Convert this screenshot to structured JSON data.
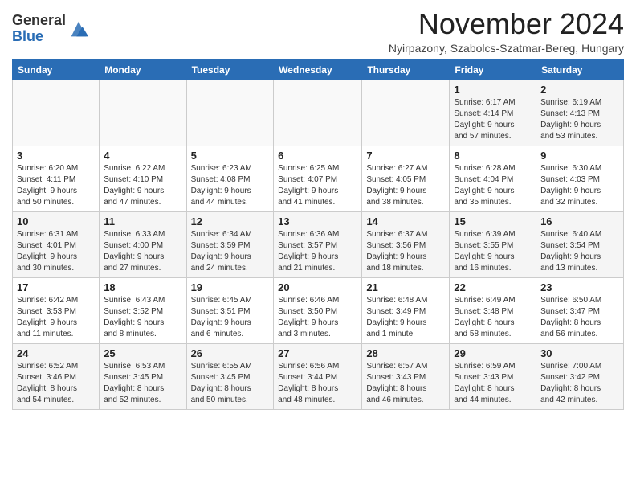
{
  "header": {
    "logo_line1": "General",
    "logo_line2": "Blue",
    "month": "November 2024",
    "location": "Nyirpazony, Szabolcs-Szatmar-Bereg, Hungary"
  },
  "days_of_week": [
    "Sunday",
    "Monday",
    "Tuesday",
    "Wednesday",
    "Thursday",
    "Friday",
    "Saturday"
  ],
  "weeks": [
    [
      {
        "day": "",
        "info": ""
      },
      {
        "day": "",
        "info": ""
      },
      {
        "day": "",
        "info": ""
      },
      {
        "day": "",
        "info": ""
      },
      {
        "day": "",
        "info": ""
      },
      {
        "day": "1",
        "info": "Sunrise: 6:17 AM\nSunset: 4:14 PM\nDaylight: 9 hours\nand 57 minutes."
      },
      {
        "day": "2",
        "info": "Sunrise: 6:19 AM\nSunset: 4:13 PM\nDaylight: 9 hours\nand 53 minutes."
      }
    ],
    [
      {
        "day": "3",
        "info": "Sunrise: 6:20 AM\nSunset: 4:11 PM\nDaylight: 9 hours\nand 50 minutes."
      },
      {
        "day": "4",
        "info": "Sunrise: 6:22 AM\nSunset: 4:10 PM\nDaylight: 9 hours\nand 47 minutes."
      },
      {
        "day": "5",
        "info": "Sunrise: 6:23 AM\nSunset: 4:08 PM\nDaylight: 9 hours\nand 44 minutes."
      },
      {
        "day": "6",
        "info": "Sunrise: 6:25 AM\nSunset: 4:07 PM\nDaylight: 9 hours\nand 41 minutes."
      },
      {
        "day": "7",
        "info": "Sunrise: 6:27 AM\nSunset: 4:05 PM\nDaylight: 9 hours\nand 38 minutes."
      },
      {
        "day": "8",
        "info": "Sunrise: 6:28 AM\nSunset: 4:04 PM\nDaylight: 9 hours\nand 35 minutes."
      },
      {
        "day": "9",
        "info": "Sunrise: 6:30 AM\nSunset: 4:03 PM\nDaylight: 9 hours\nand 32 minutes."
      }
    ],
    [
      {
        "day": "10",
        "info": "Sunrise: 6:31 AM\nSunset: 4:01 PM\nDaylight: 9 hours\nand 30 minutes."
      },
      {
        "day": "11",
        "info": "Sunrise: 6:33 AM\nSunset: 4:00 PM\nDaylight: 9 hours\nand 27 minutes."
      },
      {
        "day": "12",
        "info": "Sunrise: 6:34 AM\nSunset: 3:59 PM\nDaylight: 9 hours\nand 24 minutes."
      },
      {
        "day": "13",
        "info": "Sunrise: 6:36 AM\nSunset: 3:57 PM\nDaylight: 9 hours\nand 21 minutes."
      },
      {
        "day": "14",
        "info": "Sunrise: 6:37 AM\nSunset: 3:56 PM\nDaylight: 9 hours\nand 18 minutes."
      },
      {
        "day": "15",
        "info": "Sunrise: 6:39 AM\nSunset: 3:55 PM\nDaylight: 9 hours\nand 16 minutes."
      },
      {
        "day": "16",
        "info": "Sunrise: 6:40 AM\nSunset: 3:54 PM\nDaylight: 9 hours\nand 13 minutes."
      }
    ],
    [
      {
        "day": "17",
        "info": "Sunrise: 6:42 AM\nSunset: 3:53 PM\nDaylight: 9 hours\nand 11 minutes."
      },
      {
        "day": "18",
        "info": "Sunrise: 6:43 AM\nSunset: 3:52 PM\nDaylight: 9 hours\nand 8 minutes."
      },
      {
        "day": "19",
        "info": "Sunrise: 6:45 AM\nSunset: 3:51 PM\nDaylight: 9 hours\nand 6 minutes."
      },
      {
        "day": "20",
        "info": "Sunrise: 6:46 AM\nSunset: 3:50 PM\nDaylight: 9 hours\nand 3 minutes."
      },
      {
        "day": "21",
        "info": "Sunrise: 6:48 AM\nSunset: 3:49 PM\nDaylight: 9 hours\nand 1 minute."
      },
      {
        "day": "22",
        "info": "Sunrise: 6:49 AM\nSunset: 3:48 PM\nDaylight: 8 hours\nand 58 minutes."
      },
      {
        "day": "23",
        "info": "Sunrise: 6:50 AM\nSunset: 3:47 PM\nDaylight: 8 hours\nand 56 minutes."
      }
    ],
    [
      {
        "day": "24",
        "info": "Sunrise: 6:52 AM\nSunset: 3:46 PM\nDaylight: 8 hours\nand 54 minutes."
      },
      {
        "day": "25",
        "info": "Sunrise: 6:53 AM\nSunset: 3:45 PM\nDaylight: 8 hours\nand 52 minutes."
      },
      {
        "day": "26",
        "info": "Sunrise: 6:55 AM\nSunset: 3:45 PM\nDaylight: 8 hours\nand 50 minutes."
      },
      {
        "day": "27",
        "info": "Sunrise: 6:56 AM\nSunset: 3:44 PM\nDaylight: 8 hours\nand 48 minutes."
      },
      {
        "day": "28",
        "info": "Sunrise: 6:57 AM\nSunset: 3:43 PM\nDaylight: 8 hours\nand 46 minutes."
      },
      {
        "day": "29",
        "info": "Sunrise: 6:59 AM\nSunset: 3:43 PM\nDaylight: 8 hours\nand 44 minutes."
      },
      {
        "day": "30",
        "info": "Sunrise: 7:00 AM\nSunset: 3:42 PM\nDaylight: 8 hours\nand 42 minutes."
      }
    ]
  ]
}
